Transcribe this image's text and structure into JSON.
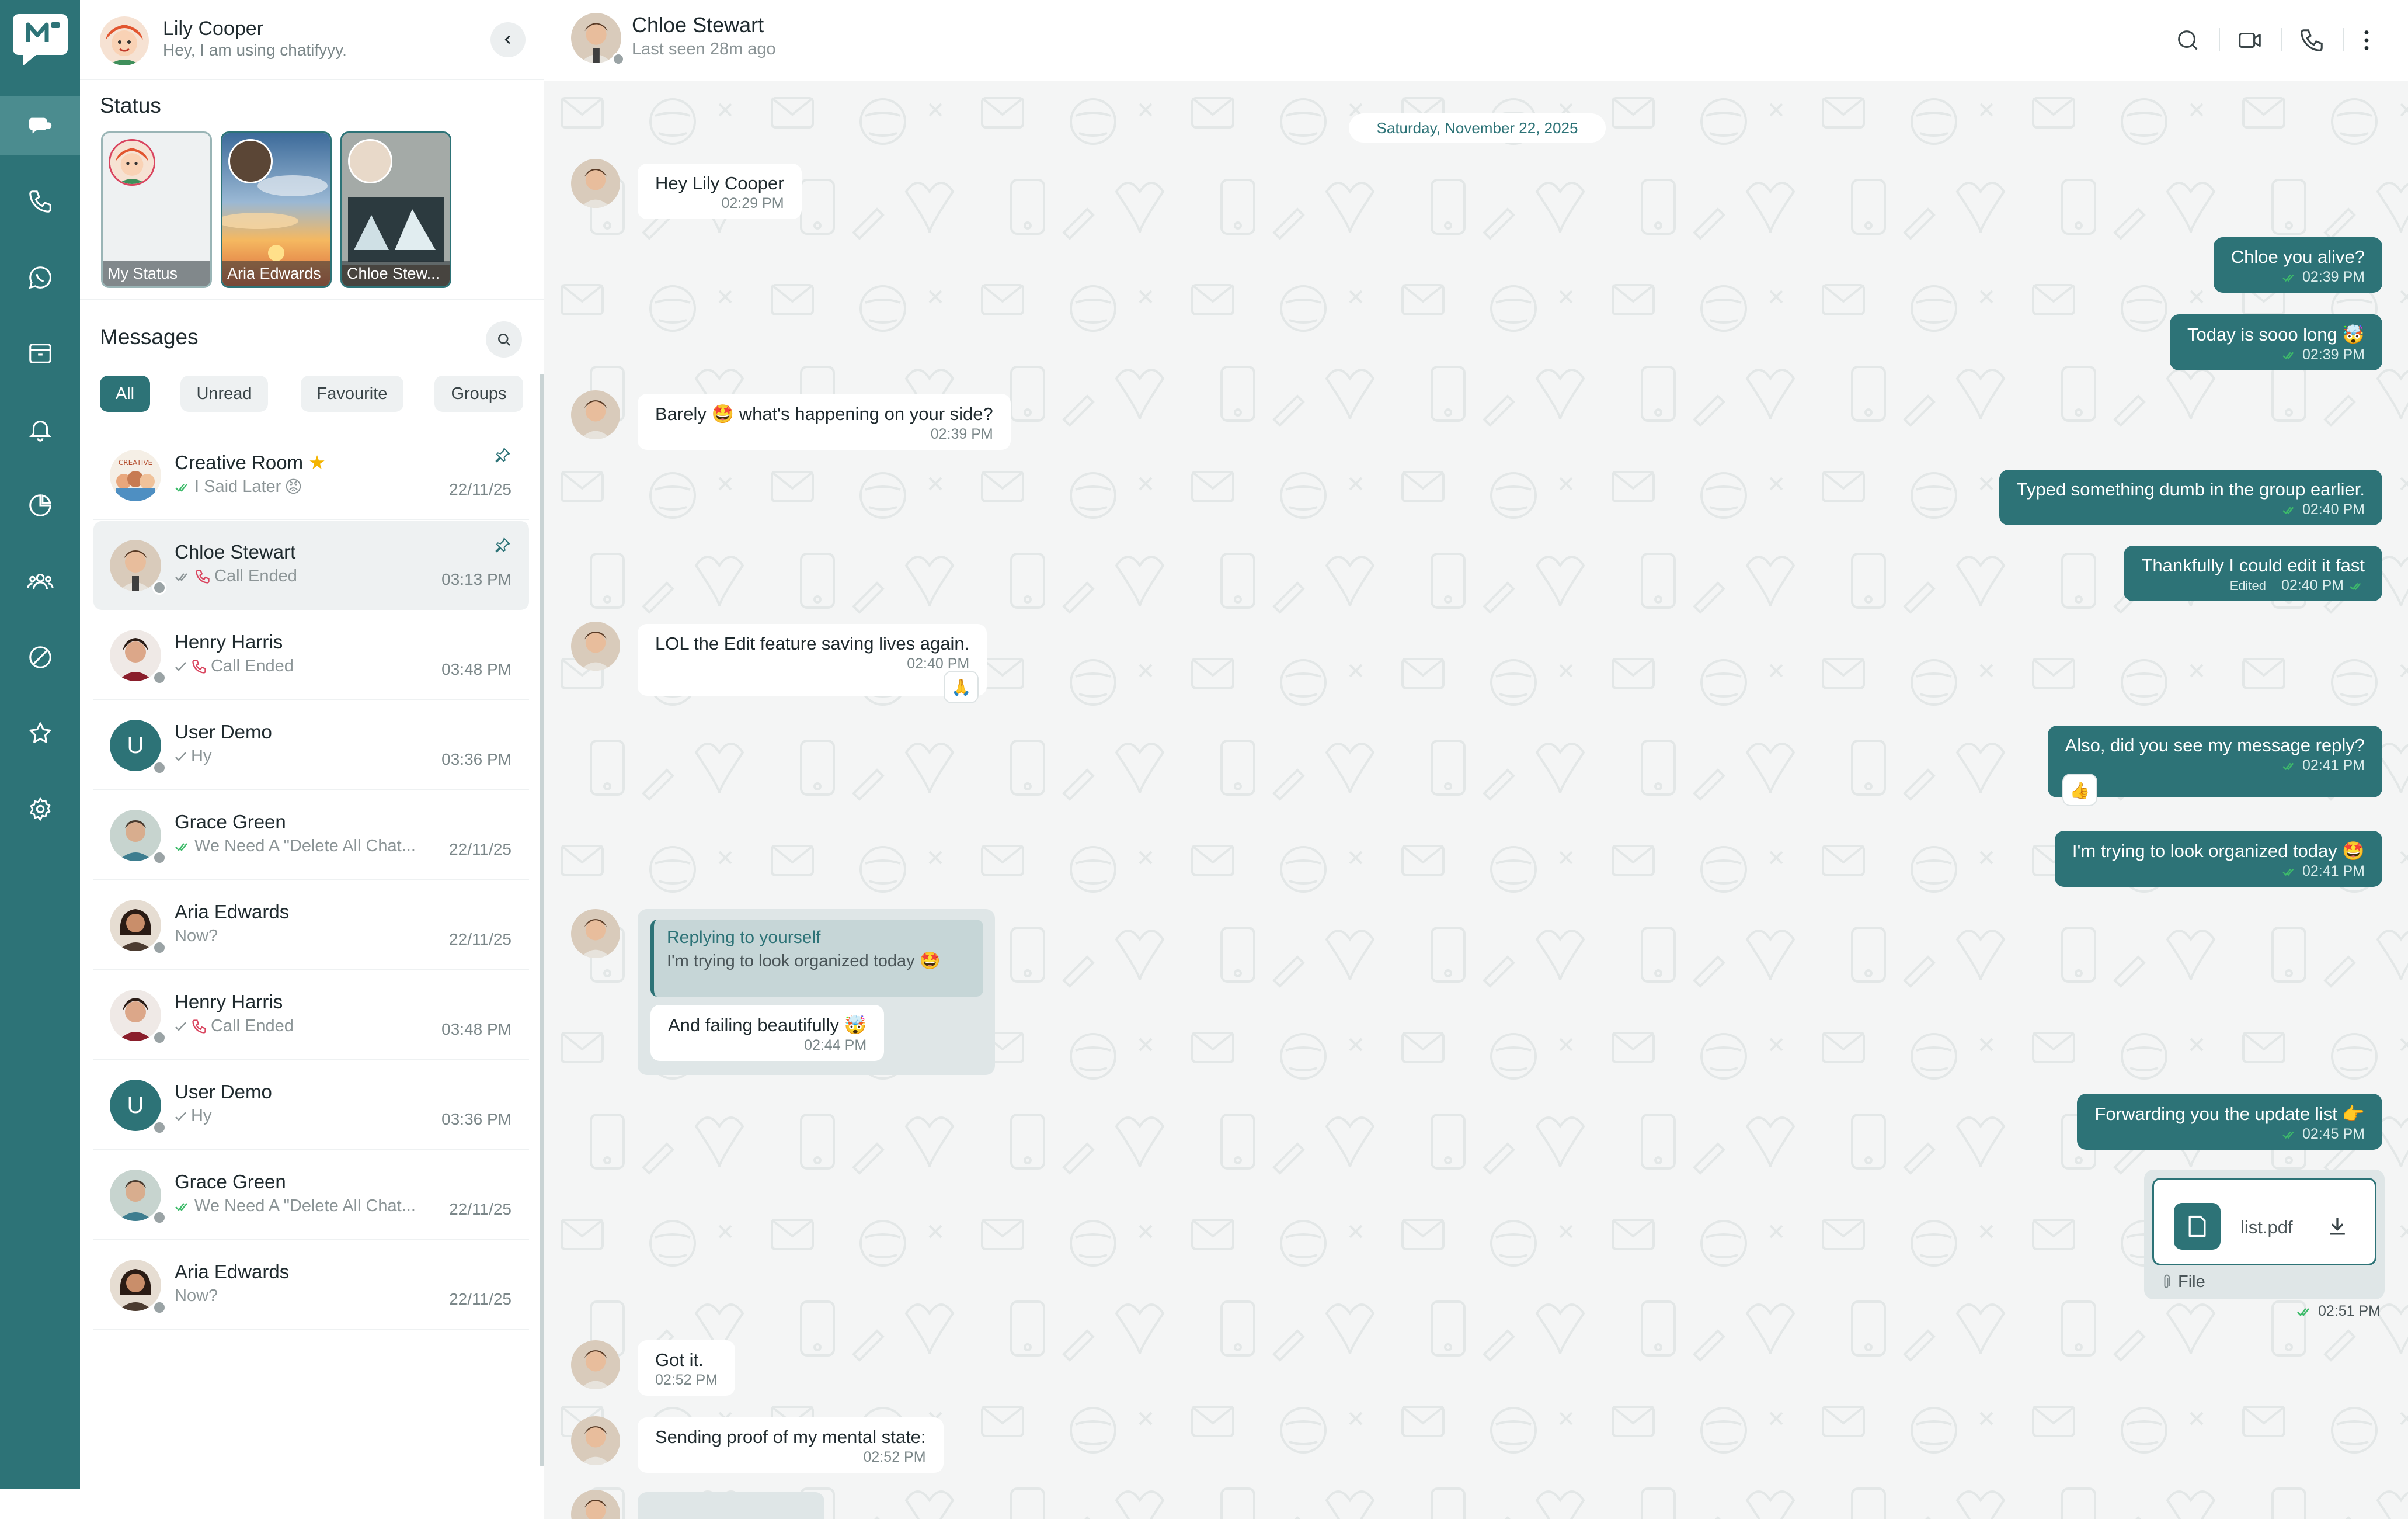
{
  "current_user": {
    "name": "Lily Cooper",
    "about": "Hey, I am using chatifyyy."
  },
  "status": {
    "title": "Status",
    "items": [
      {
        "label": "My Status"
      },
      {
        "label": "Aria Edwards"
      },
      {
        "label": "Chloe Stew..."
      }
    ]
  },
  "messages_panel": {
    "title": "Messages",
    "filters": [
      "All",
      "Unread",
      "Favourite",
      "Groups"
    ],
    "active_filter": "All",
    "chats": [
      {
        "name": "Creative Room",
        "preview": "I Said Later",
        "time": "22/11/25",
        "pinned": true,
        "starred": true,
        "preview_emoji": "😡",
        "avatar_initial": "",
        "call": false
      },
      {
        "name": "Chloe Stewart",
        "preview": "Call Ended",
        "time": "03:13 PM",
        "pinned": true,
        "selected": true,
        "call": true
      },
      {
        "name": "Henry Harris",
        "preview": "Call Ended",
        "time": "03:48 PM",
        "call": true
      },
      {
        "name": "User Demo",
        "preview": "Hy",
        "time": "03:36 PM",
        "avatar_initial": "U",
        "call": false
      },
      {
        "name": "Grace Green",
        "preview": "We Need A \"Delete All Chat...",
        "time": "22/11/25",
        "call": false
      },
      {
        "name": "Aria Edwards",
        "preview": "Now?",
        "time": "22/11/25",
        "call": false
      },
      {
        "name": "Henry Harris",
        "preview": "Call Ended",
        "time": "03:48 PM",
        "call": true
      },
      {
        "name": "User Demo",
        "preview": "Hy",
        "time": "03:36 PM",
        "avatar_initial": "U",
        "call": false
      },
      {
        "name": "Grace Green",
        "preview": "We Need A \"Delete All Chat...",
        "time": "22/11/25",
        "call": false
      },
      {
        "name": "Aria Edwards",
        "preview": "Now?",
        "time": "22/11/25",
        "call": false
      }
    ]
  },
  "chat_header": {
    "name": "Chloe Stewart",
    "last_seen": "Last seen 28m ago"
  },
  "conversation": {
    "date": "Saturday, November 22, 2025",
    "messages": [
      {
        "dir": "in",
        "text": "Hey Lily Cooper",
        "time": "02:29 PM"
      },
      {
        "dir": "out",
        "text": "Chloe you alive?",
        "time": "02:39 PM"
      },
      {
        "dir": "out",
        "text": "Today is sooo long 🤯",
        "time": "02:39 PM"
      },
      {
        "dir": "in",
        "text": "Barely 🤩 what's happening on your side?",
        "time": "02:39 PM"
      },
      {
        "dir": "out",
        "text": "Typed something dumb in the group earlier.",
        "time": "02:40 PM"
      },
      {
        "dir": "out",
        "text": "Thankfully I could edit it fast",
        "time": "02:40 PM",
        "edited_label": "Edited"
      },
      {
        "dir": "in",
        "text": "LOL the Edit feature saving lives again.",
        "time": "02:40 PM",
        "reaction": "🙏"
      },
      {
        "dir": "out",
        "text": "Also, did you see my message reply?",
        "time": "02:41 PM",
        "reaction": "👍"
      },
      {
        "dir": "out",
        "text": "I'm trying to look organized today 🤩",
        "time": "02:41 PM"
      },
      {
        "dir": "in",
        "reply_title": "Replying to yourself",
        "reply_text": "I'm trying to look organized today 🤩",
        "text": "And failing beautifully 🤯",
        "time": "02:44 PM"
      },
      {
        "dir": "out",
        "text": "Forwarding you the update list 👉",
        "time": "02:45 PM"
      },
      {
        "dir": "out",
        "file_name": "list.pdf",
        "file_type": "File",
        "time": "02:51 PM"
      },
      {
        "dir": "in",
        "text": "Got it.",
        "time": "02:52 PM"
      },
      {
        "dir": "in",
        "text": "Sending proof of my mental state:",
        "time": "02:52 PM"
      }
    ]
  },
  "colors": {
    "brand": "#2d7377",
    "rail_active": "#4b8c8f",
    "chat_bg": "#f4f5f5",
    "call_red": "#d9455f",
    "read_tick": "#3dbb6a"
  }
}
